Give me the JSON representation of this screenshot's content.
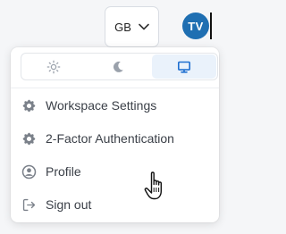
{
  "header": {
    "language": "GB",
    "avatar_initials": "TV"
  },
  "theme_switcher": {
    "options": [
      {
        "name": "light",
        "icon": "sun-icon",
        "active": false
      },
      {
        "name": "dark",
        "icon": "moon-icon",
        "active": false
      },
      {
        "name": "system",
        "icon": "monitor-icon",
        "active": true
      }
    ]
  },
  "menu": {
    "items": [
      {
        "label": "Workspace Settings",
        "icon": "gear-icon"
      },
      {
        "label": "2-Factor Authentication",
        "icon": "gear-icon"
      },
      {
        "label": "Profile",
        "icon": "user-circle-icon"
      },
      {
        "label": "Sign out",
        "icon": "sign-out-icon"
      }
    ]
  },
  "colors": {
    "avatar_bg": "#1f6fb2",
    "active_accent": "#1e6fd0",
    "active_bg": "#eaf2fb"
  }
}
